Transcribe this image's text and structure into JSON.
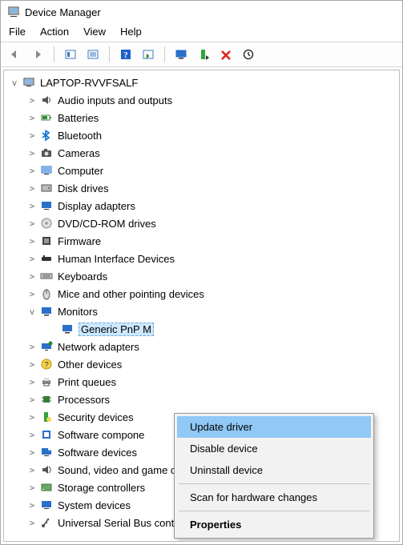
{
  "window_title": "Device Manager",
  "menu": {
    "file": "File",
    "action": "Action",
    "view": "View",
    "help": "Help"
  },
  "root_name": "LAPTOP-RVVFSALF",
  "categories": [
    {
      "label": "Audio inputs and outputs",
      "icon": "speaker",
      "expanded": false
    },
    {
      "label": "Batteries",
      "icon": "battery",
      "expanded": false
    },
    {
      "label": "Bluetooth",
      "icon": "bluetooth",
      "expanded": false
    },
    {
      "label": "Cameras",
      "icon": "camera",
      "expanded": false
    },
    {
      "label": "Computer",
      "icon": "computer",
      "expanded": false
    },
    {
      "label": "Disk drives",
      "icon": "disk",
      "expanded": false
    },
    {
      "label": "Display adapters",
      "icon": "display",
      "expanded": false
    },
    {
      "label": "DVD/CD-ROM drives",
      "icon": "cdrom",
      "expanded": false
    },
    {
      "label": "Firmware",
      "icon": "firmware",
      "expanded": false
    },
    {
      "label": "Human Interface Devices",
      "icon": "hid",
      "expanded": false
    },
    {
      "label": "Keyboards",
      "icon": "keyboard",
      "expanded": false
    },
    {
      "label": "Mice and other pointing devices",
      "icon": "mouse",
      "expanded": false
    },
    {
      "label": "Monitors",
      "icon": "monitor",
      "expanded": true
    },
    {
      "label": "Network adapters",
      "icon": "network",
      "expanded": false
    },
    {
      "label": "Other devices",
      "icon": "other",
      "expanded": false
    },
    {
      "label": "Print queues",
      "icon": "printer",
      "expanded": false
    },
    {
      "label": "Processors",
      "icon": "cpu",
      "expanded": false
    },
    {
      "label": "Security devices",
      "icon": "security",
      "expanded": false
    },
    {
      "label": "Software components",
      "icon": "swcomp",
      "expanded": false,
      "truncated_label": "Software compone"
    },
    {
      "label": "Software devices",
      "icon": "swdev",
      "expanded": false
    },
    {
      "label": "Sound, video and game controllers",
      "icon": "sound",
      "expanded": false
    },
    {
      "label": "Storage controllers",
      "icon": "storage",
      "expanded": false
    },
    {
      "label": "System devices",
      "icon": "system",
      "expanded": false
    },
    {
      "label": "Universal Serial Bus controllers",
      "icon": "usb",
      "expanded": false
    }
  ],
  "monitor_child": "Generic PnP Monitor",
  "monitor_child_visible": "Generic PnP M",
  "context_menu": {
    "update": "Update driver",
    "disable": "Disable device",
    "uninstall": "Uninstall device",
    "scan": "Scan for hardware changes",
    "properties": "Properties"
  }
}
